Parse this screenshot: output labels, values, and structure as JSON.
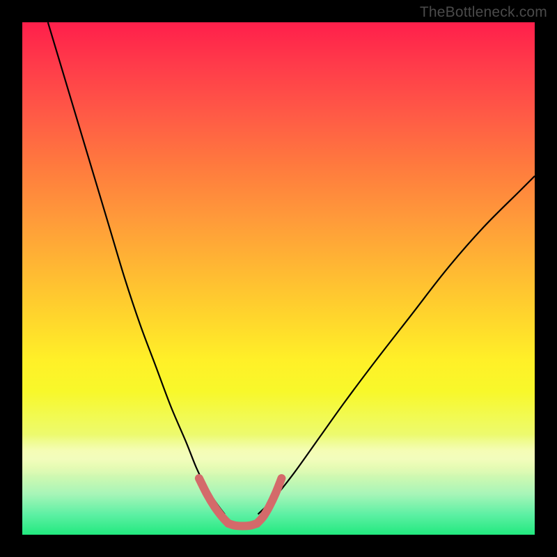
{
  "watermark": "TheBottleneck.com",
  "chart_data": {
    "type": "line",
    "title": "",
    "xlabel": "",
    "ylabel": "",
    "xlim": [
      0,
      100
    ],
    "ylim": [
      0,
      100
    ],
    "grid": false,
    "legend": null,
    "background_gradient": {
      "top": "#ff1f4b",
      "mid": "#ffe92a",
      "bottom": "#22e97f"
    },
    "series": [
      {
        "name": "left-curve",
        "color": "#000000",
        "x": [
          5,
          8,
          11,
          14,
          17,
          20,
          23,
          26,
          29,
          32,
          34,
          36,
          38,
          39.5
        ],
        "y": [
          100,
          90,
          80,
          70,
          60,
          50,
          41,
          33,
          25,
          18,
          13,
          9,
          6,
          4
        ]
      },
      {
        "name": "right-curve",
        "color": "#000000",
        "x": [
          46,
          49,
          53,
          58,
          63,
          69,
          76,
          83,
          90,
          97,
          100
        ],
        "y": [
          4,
          7,
          12,
          19,
          26,
          34,
          43,
          52,
          60,
          67,
          70
        ]
      },
      {
        "name": "highlight-left",
        "color": "#d46a6a",
        "thick": true,
        "x": [
          34.5,
          36,
          37.5,
          39,
          40.2
        ],
        "y": [
          11,
          8,
          5.5,
          3.5,
          2.2
        ]
      },
      {
        "name": "highlight-bottom",
        "color": "#d46a6a",
        "thick": true,
        "x": [
          40.2,
          41.5,
          43,
          44.5,
          45.8
        ],
        "y": [
          2.2,
          1.8,
          1.7,
          1.8,
          2.2
        ]
      },
      {
        "name": "highlight-right",
        "color": "#d46a6a",
        "thick": true,
        "x": [
          45.8,
          47,
          48.2,
          49.4,
          50.6
        ],
        "y": [
          2.2,
          3.5,
          5.5,
          8,
          11
        ]
      }
    ]
  }
}
